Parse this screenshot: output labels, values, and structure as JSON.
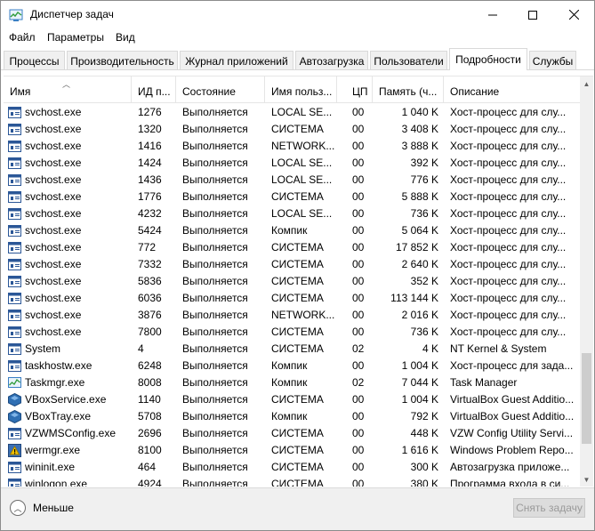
{
  "window": {
    "title": "Диспетчер задач",
    "controls": {
      "minimize": "—",
      "maximize": "☐",
      "close": "✕"
    }
  },
  "menu": [
    "Файл",
    "Параметры",
    "Вид"
  ],
  "tabs": [
    {
      "label": "Процессы",
      "active": false
    },
    {
      "label": "Производительность",
      "active": false
    },
    {
      "label": "Журнал приложений",
      "active": false
    },
    {
      "label": "Автозагрузка",
      "active": false
    },
    {
      "label": "Пользователи",
      "active": false
    },
    {
      "label": "Подробности",
      "active": true
    },
    {
      "label": "Службы",
      "active": false
    }
  ],
  "columns": {
    "name": "Имя",
    "pid": "ИД п...",
    "status": "Состояние",
    "user": "Имя польз...",
    "cpu": "ЦП",
    "memory": "Память (ч...",
    "description": "Описание"
  },
  "rows": [
    {
      "icon": "service-host-icon",
      "name": "svchost.exe",
      "pid": "1276",
      "status": "Выполняется",
      "user": "LOCAL SE...",
      "cpu": "00",
      "memory": "1 040 K",
      "description": "Хост-процесс для слу..."
    },
    {
      "icon": "service-host-icon",
      "name": "svchost.exe",
      "pid": "1320",
      "status": "Выполняется",
      "user": "СИСТЕМА",
      "cpu": "00",
      "memory": "3 408 K",
      "description": "Хост-процесс для слу..."
    },
    {
      "icon": "service-host-icon",
      "name": "svchost.exe",
      "pid": "1416",
      "status": "Выполняется",
      "user": "NETWORK...",
      "cpu": "00",
      "memory": "3 888 K",
      "description": "Хост-процесс для слу..."
    },
    {
      "icon": "service-host-icon",
      "name": "svchost.exe",
      "pid": "1424",
      "status": "Выполняется",
      "user": "LOCAL SE...",
      "cpu": "00",
      "memory": "392 K",
      "description": "Хост-процесс для слу..."
    },
    {
      "icon": "service-host-icon",
      "name": "svchost.exe",
      "pid": "1436",
      "status": "Выполняется",
      "user": "LOCAL SE...",
      "cpu": "00",
      "memory": "776 K",
      "description": "Хост-процесс для слу..."
    },
    {
      "icon": "service-host-icon",
      "name": "svchost.exe",
      "pid": "1776",
      "status": "Выполняется",
      "user": "СИСТЕМА",
      "cpu": "00",
      "memory": "5 888 K",
      "description": "Хост-процесс для слу..."
    },
    {
      "icon": "service-host-icon",
      "name": "svchost.exe",
      "pid": "4232",
      "status": "Выполняется",
      "user": "LOCAL SE...",
      "cpu": "00",
      "memory": "736 K",
      "description": "Хост-процесс для слу..."
    },
    {
      "icon": "service-host-icon",
      "name": "svchost.exe",
      "pid": "5424",
      "status": "Выполняется",
      "user": "Компик",
      "cpu": "00",
      "memory": "5 064 K",
      "description": "Хост-процесс для слу..."
    },
    {
      "icon": "service-host-icon",
      "name": "svchost.exe",
      "pid": "772",
      "status": "Выполняется",
      "user": "СИСТЕМА",
      "cpu": "00",
      "memory": "17 852 K",
      "description": "Хост-процесс для слу..."
    },
    {
      "icon": "service-host-icon",
      "name": "svchost.exe",
      "pid": "7332",
      "status": "Выполняется",
      "user": "СИСТЕМА",
      "cpu": "00",
      "memory": "2 640 K",
      "description": "Хост-процесс для слу..."
    },
    {
      "icon": "service-host-icon",
      "name": "svchost.exe",
      "pid": "5836",
      "status": "Выполняется",
      "user": "СИСТЕМА",
      "cpu": "00",
      "memory": "352 K",
      "description": "Хост-процесс для слу..."
    },
    {
      "icon": "service-host-icon",
      "name": "svchost.exe",
      "pid": "6036",
      "status": "Выполняется",
      "user": "СИСТЕМА",
      "cpu": "00",
      "memory": "113 144 K",
      "description": "Хост-процесс для слу..."
    },
    {
      "icon": "service-host-icon",
      "name": "svchost.exe",
      "pid": "3876",
      "status": "Выполняется",
      "user": "NETWORK...",
      "cpu": "00",
      "memory": "2 016 K",
      "description": "Хост-процесс для слу..."
    },
    {
      "icon": "service-host-icon",
      "name": "svchost.exe",
      "pid": "7800",
      "status": "Выполняется",
      "user": "СИСТЕМА",
      "cpu": "00",
      "memory": "736 K",
      "description": "Хост-процесс для слу..."
    },
    {
      "icon": "service-host-icon",
      "name": "System",
      "pid": "4",
      "status": "Выполняется",
      "user": "СИСТЕМА",
      "cpu": "02",
      "memory": "4 K",
      "description": "NT Kernel & System"
    },
    {
      "icon": "service-host-icon",
      "name": "taskhostw.exe",
      "pid": "6248",
      "status": "Выполняется",
      "user": "Компик",
      "cpu": "00",
      "memory": "1 004 K",
      "description": "Хост-процесс для зада..."
    },
    {
      "icon": "task-manager-icon",
      "name": "Taskmgr.exe",
      "pid": "8008",
      "status": "Выполняется",
      "user": "Компик",
      "cpu": "02",
      "memory": "7 044 K",
      "description": "Task Manager"
    },
    {
      "icon": "virtualbox-icon",
      "name": "VBoxService.exe",
      "pid": "1140",
      "status": "Выполняется",
      "user": "СИСТЕМА",
      "cpu": "00",
      "memory": "1 004 K",
      "description": "VirtualBox Guest Additio..."
    },
    {
      "icon": "virtualbox-icon",
      "name": "VBoxTray.exe",
      "pid": "5708",
      "status": "Выполняется",
      "user": "Компик",
      "cpu": "00",
      "memory": "792 K",
      "description": "VirtualBox Guest Additio..."
    },
    {
      "icon": "service-host-icon",
      "name": "VZWMSConfig.exe",
      "pid": "2696",
      "status": "Выполняется",
      "user": "СИСТЕМА",
      "cpu": "00",
      "memory": "448 K",
      "description": "VZW Config Utility Servi..."
    },
    {
      "icon": "problem-report-icon",
      "name": "wermgr.exe",
      "pid": "8100",
      "status": "Выполняется",
      "user": "СИСТЕМА",
      "cpu": "00",
      "memory": "1 616 K",
      "description": "Windows Problem Repo..."
    },
    {
      "icon": "service-host-icon",
      "name": "wininit.exe",
      "pid": "464",
      "status": "Выполняется",
      "user": "СИСТЕМА",
      "cpu": "00",
      "memory": "300 K",
      "description": "Автозагрузка приложе..."
    },
    {
      "icon": "service-host-icon",
      "name": "winlogon.exe",
      "pid": "4924",
      "status": "Выполняется",
      "user": "СИСТЕМА",
      "cpu": "00",
      "memory": "380 K",
      "description": "Программа входа в си..."
    }
  ],
  "footer": {
    "less_label": "Меньше",
    "end_task_label": "Снять задачу"
  },
  "colors": {
    "accent": "#0078d7",
    "disabled_text": "#9a9a9a",
    "footer_bg": "#f0f0f0"
  }
}
